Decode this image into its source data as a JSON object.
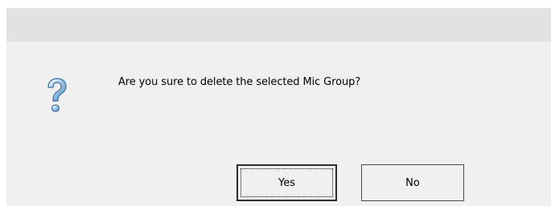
{
  "dialog": {
    "title": "",
    "message": "Are you sure to delete the selected Mic Group?",
    "icon": "question-icon",
    "buttons": {
      "yes_label": "Yes",
      "no_label": "No"
    },
    "default_button": "Yes"
  }
}
